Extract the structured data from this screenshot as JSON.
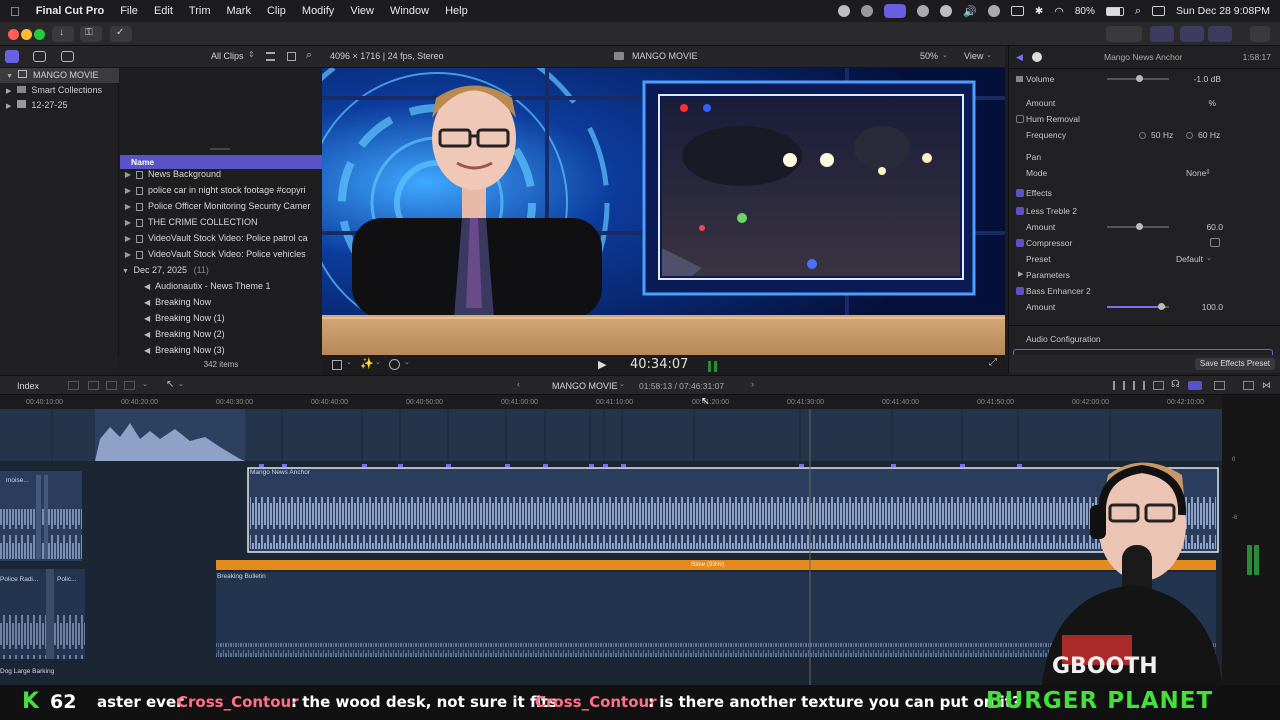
{
  "menubar": {
    "app_name": "Final Cut Pro",
    "items": [
      "File",
      "Edit",
      "Trim",
      "Mark",
      "Clip",
      "Modify",
      "View",
      "Window",
      "Help"
    ],
    "battery": "80%",
    "datetime": "Sun Dec 28  9:08PM"
  },
  "browser": {
    "filter_label": "All Clips",
    "library_name": "MANGO MOVIE",
    "library_items": [
      "Smart Collections",
      "12-27-25"
    ],
    "name_header": "Name",
    "clips": [
      {
        "label": "News Background",
        "kind": "folder"
      },
      {
        "label": "police  car in night stock footage #copyri",
        "kind": "video"
      },
      {
        "label": "Police Officer Monitoring Security Camer",
        "kind": "video"
      },
      {
        "label": "THE CRIME COLLECTION",
        "kind": "video"
      },
      {
        "label": "VideoVault Stock Video:  Police patrol ca",
        "kind": "video"
      },
      {
        "label": "VideoVault Stock Video:  Police vehicles",
        "kind": "video"
      }
    ],
    "date_group": {
      "label": "Dec 27, 2025",
      "count": "(11)"
    },
    "audio_clips": [
      "Audionautix - News Theme 1",
      "Breaking Now",
      "Breaking Now (1)",
      "Breaking Now (2)",
      "Breaking Now (3)"
    ],
    "item_count": "342 items"
  },
  "viewer": {
    "format": "4096 × 1716 | 24 fps, Stereo",
    "title": "MANGO MOVIE",
    "zoom": "50%",
    "view_label": "View",
    "timecode": "40:34:07"
  },
  "inspector": {
    "clip_name": "Mango News Anchor",
    "duration": "1:58:17",
    "volume_label": "Volume",
    "volume_value": "-1.0  dB",
    "amount_label": "Amount",
    "amount_pct": "%",
    "hum_removal": "Hum Removal",
    "frequency_label": "Frequency",
    "freq_50": "50 Hz",
    "freq_60": "60 Hz",
    "pan_label": "Pan",
    "mode_label": "Mode",
    "mode_value": "None",
    "effects_label": "Effects",
    "less_treble": "Less Treble 2",
    "less_treble_amount": "60.0",
    "compressor": "Compressor",
    "preset_label": "Preset",
    "preset_value": "Default",
    "parameters": "Parameters",
    "bass_enhancer": "Bass Enhancer 2",
    "bass_amount": "100.0",
    "audio_config": "Audio Configuration",
    "save_preset": "Save Effects Preset"
  },
  "timeline": {
    "index_label": "Index",
    "project": "MANGO MOVIE",
    "position": "01:58:13 / 07:46:31:07",
    "ruler": [
      "00:40:10:00",
      "00:40:20:00",
      "00:40:30:00",
      "00:40:40:00",
      "00:40:50:00",
      "00:41:00:00",
      "00:41:10:00",
      "00:41:20:00",
      "00:41:30:00",
      "00:41:40:00",
      "00:41:50:00",
      "00:42:00:00",
      "00:42:10:00"
    ],
    "clip_anchor": "Mango News Anchor",
    "retime_label": "Slow (93%)",
    "clip_bulletin": "Breaking Bulletin",
    "left_clips": [
      "moise...",
      "Police Radi...",
      "Polic...",
      "Dog Large Barking"
    ],
    "meter_labels": [
      "0",
      "-6"
    ]
  },
  "ticker": {
    "k_label": "K",
    "k_count": "62",
    "msg1_tail": "aster ever",
    "user1": "Cross_Contour",
    "msg1": ": the wood desk, not sure it fits",
    "user2": "Cross_Contour",
    "msg2": ": is there another texture you can put on it?",
    "brand": "BURGER PLANET"
  },
  "colors": {
    "accent": "#5a52c7",
    "ticker_green": "#44e03b",
    "ticker_pink": "#ff6f8a",
    "retime": "#e58a1d"
  }
}
